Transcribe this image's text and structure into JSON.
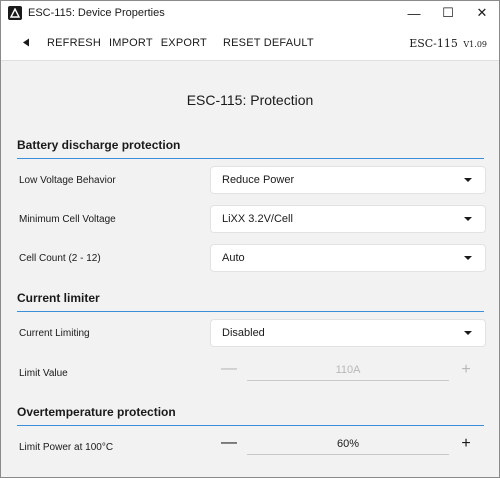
{
  "window": {
    "title": "ESC-115: Device Properties",
    "controls": {
      "minimize": "—",
      "maximize": "☐",
      "close": "✕"
    }
  },
  "toolbar": {
    "back_icon": "back-triangle-icon",
    "refresh": "REFRESH",
    "import": "IMPORT",
    "export": "EXPORT",
    "reset_default": "RESET DEFAULT",
    "model": "ESC-115",
    "version": "V1.09"
  },
  "page": {
    "title": "ESC-115: Protection"
  },
  "sections": {
    "battery": {
      "header": "Battery discharge protection",
      "low_voltage": {
        "label": "Low Voltage Behavior",
        "value": "Reduce Power"
      },
      "min_cell_voltage": {
        "label": "Minimum Cell Voltage",
        "value": "LiXX 3.2V/Cell"
      },
      "cell_count": {
        "label": "Cell Count (2 - 12)",
        "value": "Auto"
      }
    },
    "current": {
      "header": "Current limiter",
      "limiting": {
        "label": "Current Limiting",
        "value": "Disabled"
      },
      "limit_value": {
        "label": "Limit Value",
        "value": "110A",
        "enabled": false
      }
    },
    "overtemp": {
      "header": "Overtemperature protection",
      "limit_power": {
        "label": "Limit Power at 100°C",
        "value": "60%",
        "enabled": true
      }
    }
  },
  "stepper": {
    "minus": "—",
    "plus": "+"
  },
  "colors": {
    "accent": "#3a8fd8",
    "disabled_text": "#b8b8b8"
  }
}
